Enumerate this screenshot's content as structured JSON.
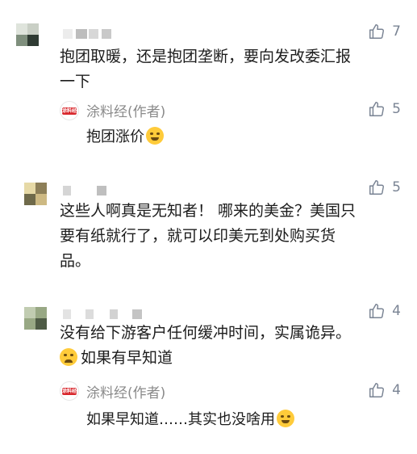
{
  "comments": [
    {
      "likes": "7",
      "text_lines": [
        "抱团取暖，还是抱团垄断，要向发改委汇报",
        "一下"
      ],
      "reply": {
        "author": "涂料经(作者)",
        "likes": "5",
        "text": "抱团涨价",
        "emoji": "hugging-face-emoji"
      }
    },
    {
      "likes": "5",
      "text_lines": [
        "这些人啊真是无知者！ 哪来的美金？美国只",
        "要有纸就行了，就可以印美元到处购买货",
        "品。"
      ]
    },
    {
      "likes": "4",
      "text_lines": [
        "没有给下游客户任何缓冲时间，实属诡异。",
        "如果有早知道"
      ],
      "second_line_emoji": "crying-face-emoji",
      "reply": {
        "author": "涂料经(作者)",
        "likes": "4",
        "text": "如果早知道……其实也没啥用",
        "emoji": "tears-of-joy-emoji"
      }
    }
  ],
  "reply_logo_text": "涂料经",
  "colors": {
    "like_gray": "#7a8494",
    "reply_name": "#8a8a8a",
    "logo_red": "#d8262b"
  }
}
